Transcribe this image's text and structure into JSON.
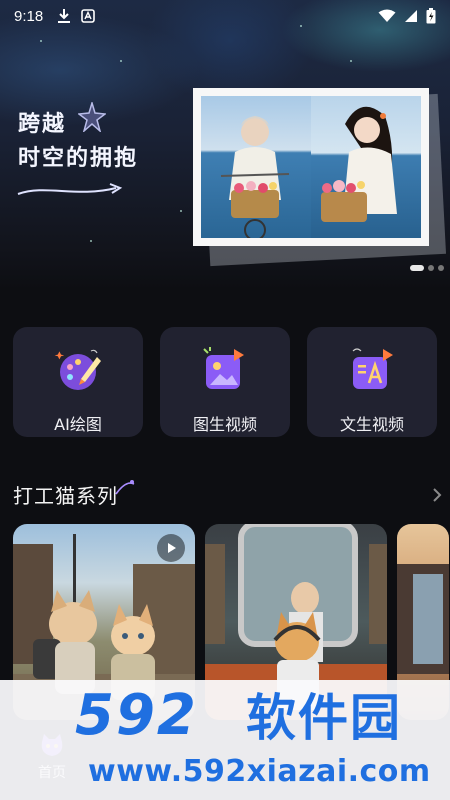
{
  "status_bar": {
    "time": "9:18"
  },
  "hero": {
    "title_line1": "跨越",
    "title_line2": "时空的拥抱",
    "carousel_total": 3,
    "carousel_active": 1
  },
  "tools": [
    {
      "label": "AI绘图",
      "icon": "palette-icon"
    },
    {
      "label": "图生视频",
      "icon": "image-video-icon"
    },
    {
      "label": "文生视频",
      "icon": "text-video-icon"
    }
  ],
  "section": {
    "title": "打工猫系列"
  },
  "bottom_nav": {
    "home_label": "首页"
  },
  "watermark": {
    "brand": "592",
    "brand_cn": "软件园",
    "url": "www.592xiazai.com"
  },
  "colors": {
    "background": "#0d0e12",
    "card": "#212230",
    "accent_purple": "#8b5cf6",
    "accent_orange": "#ff7a3d",
    "watermark_blue": "#1f6fe0"
  }
}
